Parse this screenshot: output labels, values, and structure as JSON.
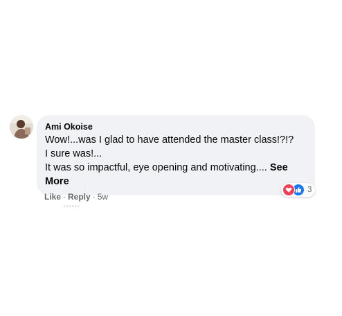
{
  "comment": {
    "author": "Ami Okoise",
    "lines": [
      "Wow!...was I glad to have attended the master class!?!?",
      "I sure was!...",
      "It was so impactful, eye opening and motivating.... "
    ],
    "see_more_part1": "See",
    "see_more_part2": "More",
    "reactions": {
      "icons": [
        "heart-icon",
        "like-thumb-icon"
      ],
      "count": "3",
      "colors": {
        "love": "#f33e58",
        "like": "#1877f2"
      }
    },
    "actions": {
      "like": "Like",
      "separator": "·",
      "reply": "Reply",
      "time": "5w"
    }
  },
  "colors": {
    "bubble": "#f0f2f5",
    "text": "#050505",
    "secondary": "#65676b"
  }
}
